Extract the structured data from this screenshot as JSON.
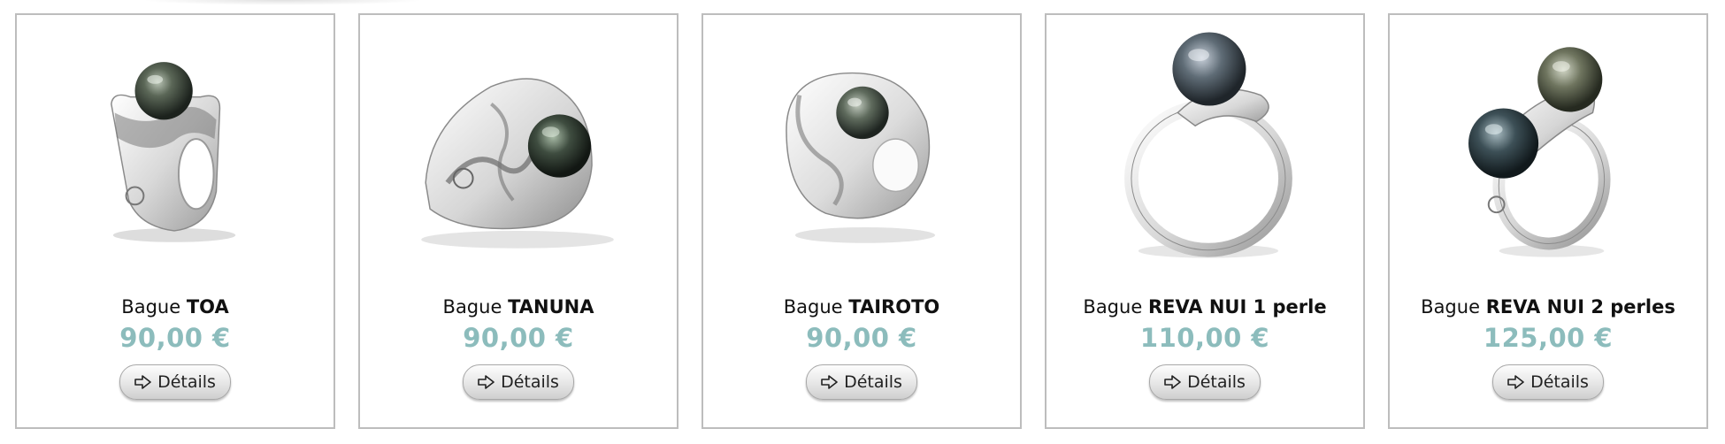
{
  "products": [
    {
      "prefix": "Bague",
      "model": "TOA",
      "price": "90,00 €",
      "button_label": "Détails",
      "button_icon": "arrow-right-outline-icon",
      "image": "ring-toa-photo"
    },
    {
      "prefix": "Bague",
      "model": "TANUNA",
      "price": "90,00 €",
      "button_label": "Détails",
      "button_icon": "arrow-right-outline-icon",
      "image": "ring-tanuna-photo"
    },
    {
      "prefix": "Bague",
      "model": "TAIROTO",
      "price": "90,00 €",
      "button_label": "Détails",
      "button_icon": "arrow-right-outline-icon",
      "image": "ring-tairoto-photo"
    },
    {
      "prefix": "Bague",
      "model": "REVA NUI 1 perle",
      "price": "110,00 €",
      "button_label": "Détails",
      "button_icon": "arrow-right-outline-icon",
      "image": "ring-reva-nui-1-photo"
    },
    {
      "prefix": "Bague",
      "model": "REVA NUI 2 perles",
      "price": "125,00 €",
      "button_label": "Détails",
      "button_icon": "arrow-right-outline-icon",
      "image": "ring-reva-nui-2-photo"
    }
  ],
  "colors": {
    "price": "#8cbcbc",
    "card_border": "#bdbdbd",
    "pearl_dark": "#2f3a34",
    "silver": "#e6e6e6"
  }
}
